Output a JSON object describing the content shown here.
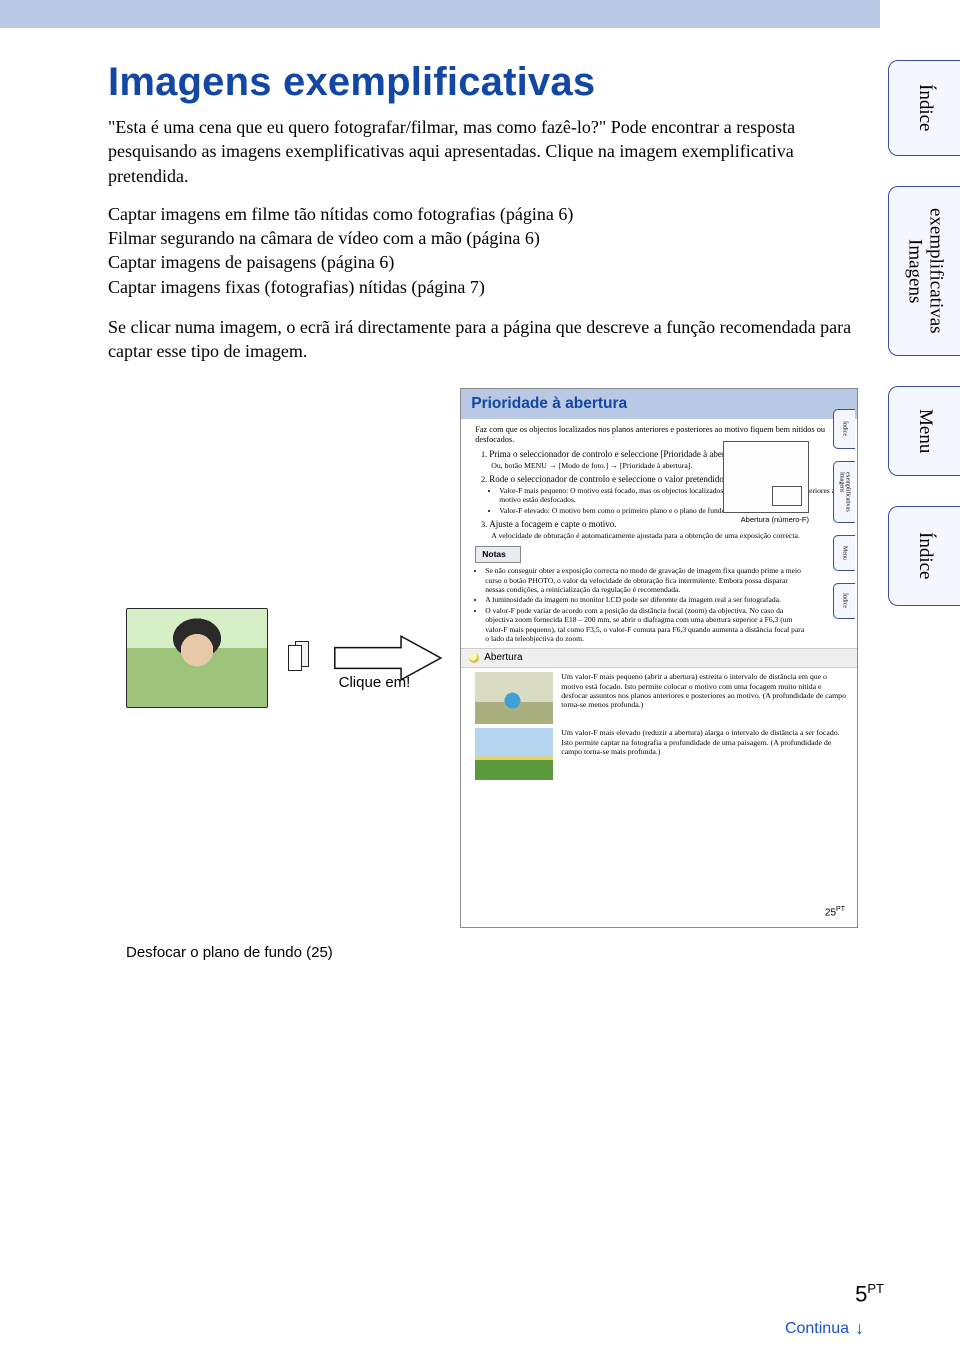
{
  "header": {
    "title": "Imagens exemplificativas"
  },
  "intro": {
    "p1": "\"Esta é uma cena que eu quero fotografar/filmar, mas como fazê-lo?\" Pode encontrar a resposta pesquisando as imagens exemplificativas aqui apresentadas. Clique na imagem exemplificativa pretendida."
  },
  "links": {
    "l1": "Captar imagens em filme tão nítidas como fotografias (página 6)",
    "l2": "Filmar segurando na câmara de vídeo com a mão (página 6)",
    "l3": "Captar imagens de paisagens (página 6)",
    "l4": "Captar imagens fixas (fotografias) nítidas (página 7)"
  },
  "p2": "Se clicar numa imagem, o ecrã irá directamente para a página que descreve a função recomendada para captar esse tipo de imagem.",
  "sideTabs": {
    "t1": "Índice",
    "t2a": "Imagens",
    "t2b": "exemplificativas",
    "t3": "Menu",
    "t4": "Índice"
  },
  "arrow": {
    "label": "Clique em!"
  },
  "caption": "Desfocar o plano de fundo (25)",
  "inset": {
    "hdr": "Prioridade à abertura",
    "lead": "Faz com que os objectos localizados nos planos anteriores e posteriores ao motivo fiquem bem nítidos ou desfocados.",
    "steps": {
      "s1": "Prima o seleccionador de controlo e seleccione [Prioridade à abertura].",
      "s1b": "Ou, botão MENU → [Modo de foto.] → [Prioridade à abertura].",
      "s2": "Rode o seleccionador de controlo e seleccione o valor pretendido.",
      "s2ul": [
        "Valor-F mais pequeno: O motivo está focado, mas os objectos localizados nos planos anteriores e posteriores ao motivo estão desfocados.",
        "Valor-F elevado: O motivo bem como o primeiro plano e o plano de fundo ficam focados."
      ],
      "s3": "Ajuste a focagem e capte o motivo.",
      "s3b": "A velocidade de obturação é automaticamente ajustada para a obtenção de uma exposição correcta."
    },
    "diagCap": "Abertura (número-F)",
    "notesLabel": "Notas",
    "notes": [
      "Se não conseguir obter a exposição correcta no modo de gravação de imagem fixa quando prime a meio curso o botão PHOTO, o valor da velocidade de obturação fica intermitente. Embora possa disparar nessas condições, a reinicialização da regulação é recomendada.",
      "A luminosidade da imagem no monitor LCD pode ser diferente da imagem real a ser fotografada.",
      "O valor-F pode variar de acordo com a posição da distância focal (zoom) da objectiva. No caso da objectiva zoom fornecida E18 – 200 mm, se abrir o diafragma com uma abertura superior a F6,3 (um valor-F mais pequeno), tal como F3,5, o valor-F comuta para F6,3 quando aumenta a distância focal para o lado da teleobjectiva do zoom."
    ],
    "abHdr": "Abertura",
    "ab1": "Um valor-F mais pequeno (abrir a abertura) estreita o intervalo de distância em que o motivo está focado. Isto permite colocar o motivo com uma focagem muito nítida e desfocar assuntos nos planos anteriores e posteriores ao motivo. (A profundidade de campo torna-se menos profunda.)",
    "ab2": "Um valor-F mais elevado (reduzir a abertura) alarga o intervalo de distância a ser focado. Isto permite captar na fotografia a profundidade de uma paisagem. (A profundidade de campo torna-se mais profunda.)",
    "miniTabs": {
      "t1": "Índice",
      "t2a": "Imagens",
      "t2b": "exemplificativas",
      "t3": "Menu",
      "t4": "Índice"
    },
    "pgnum": "25",
    "pgsup": "PT"
  },
  "pageNumber": {
    "num": "5",
    "sup": "PT"
  },
  "continue": "Continua"
}
